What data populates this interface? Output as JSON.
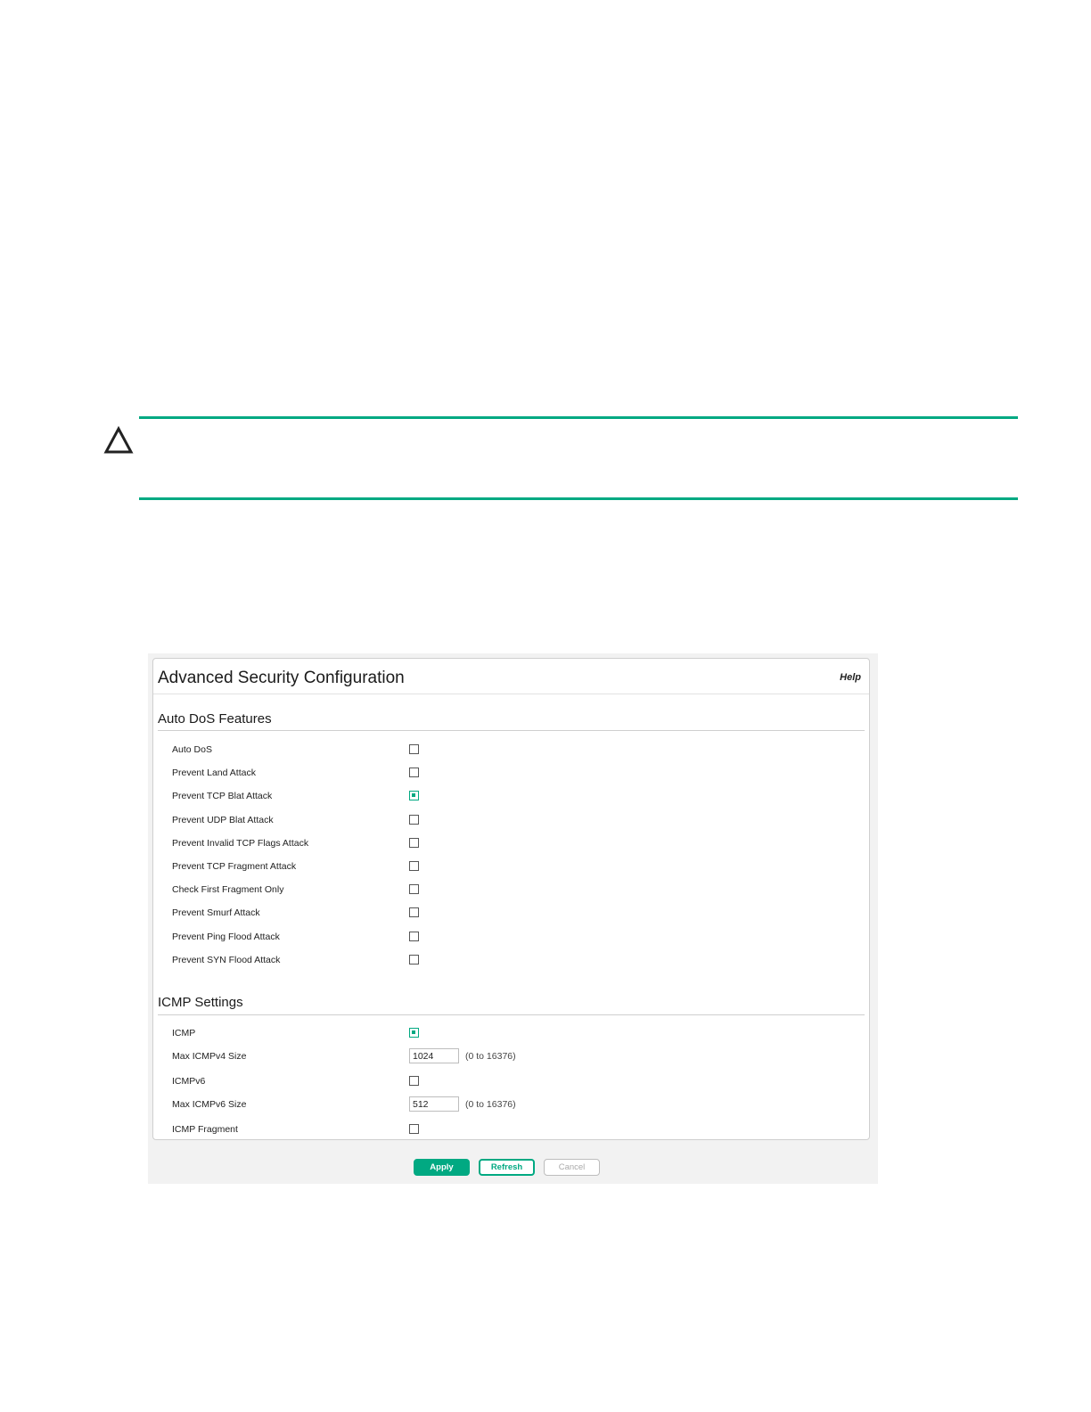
{
  "caution": {
    "icon": "warning-triangle-icon"
  },
  "panel": {
    "title": "Advanced Security Configuration",
    "help_label": "Help"
  },
  "auto_dos": {
    "title": "Auto DoS Features",
    "rows": [
      {
        "label": "Auto DoS",
        "checked": false
      },
      {
        "label": "Prevent Land Attack",
        "checked": false
      },
      {
        "label": "Prevent TCP Blat Attack",
        "checked": true
      },
      {
        "label": "Prevent UDP Blat Attack",
        "checked": false
      },
      {
        "label": "Prevent Invalid TCP Flags Attack",
        "checked": false
      },
      {
        "label": "Prevent TCP Fragment Attack",
        "checked": false
      },
      {
        "label": "Check First Fragment Only",
        "checked": false
      },
      {
        "label": "Prevent Smurf Attack",
        "checked": false
      },
      {
        "label": "Prevent Ping Flood Attack",
        "checked": false
      },
      {
        "label": "Prevent SYN Flood Attack",
        "checked": false
      }
    ]
  },
  "icmp": {
    "title": "ICMP Settings",
    "icmp": {
      "label": "ICMP",
      "checked": true
    },
    "max_icmpv4": {
      "label": "Max ICMPv4 Size",
      "value": "1024",
      "range": "(0 to 16376)"
    },
    "icmpv6": {
      "label": "ICMPv6",
      "checked": false
    },
    "max_icmpv6": {
      "label": "Max ICMPv6 Size",
      "value": "512",
      "range": "(0 to 16376)"
    },
    "icmp_fragment": {
      "label": "ICMP Fragment",
      "checked": false
    }
  },
  "buttons": {
    "apply": "Apply",
    "refresh": "Refresh",
    "cancel": "Cancel"
  },
  "colors": {
    "accent": "#01a982",
    "disabled": "#bdbdbd"
  }
}
